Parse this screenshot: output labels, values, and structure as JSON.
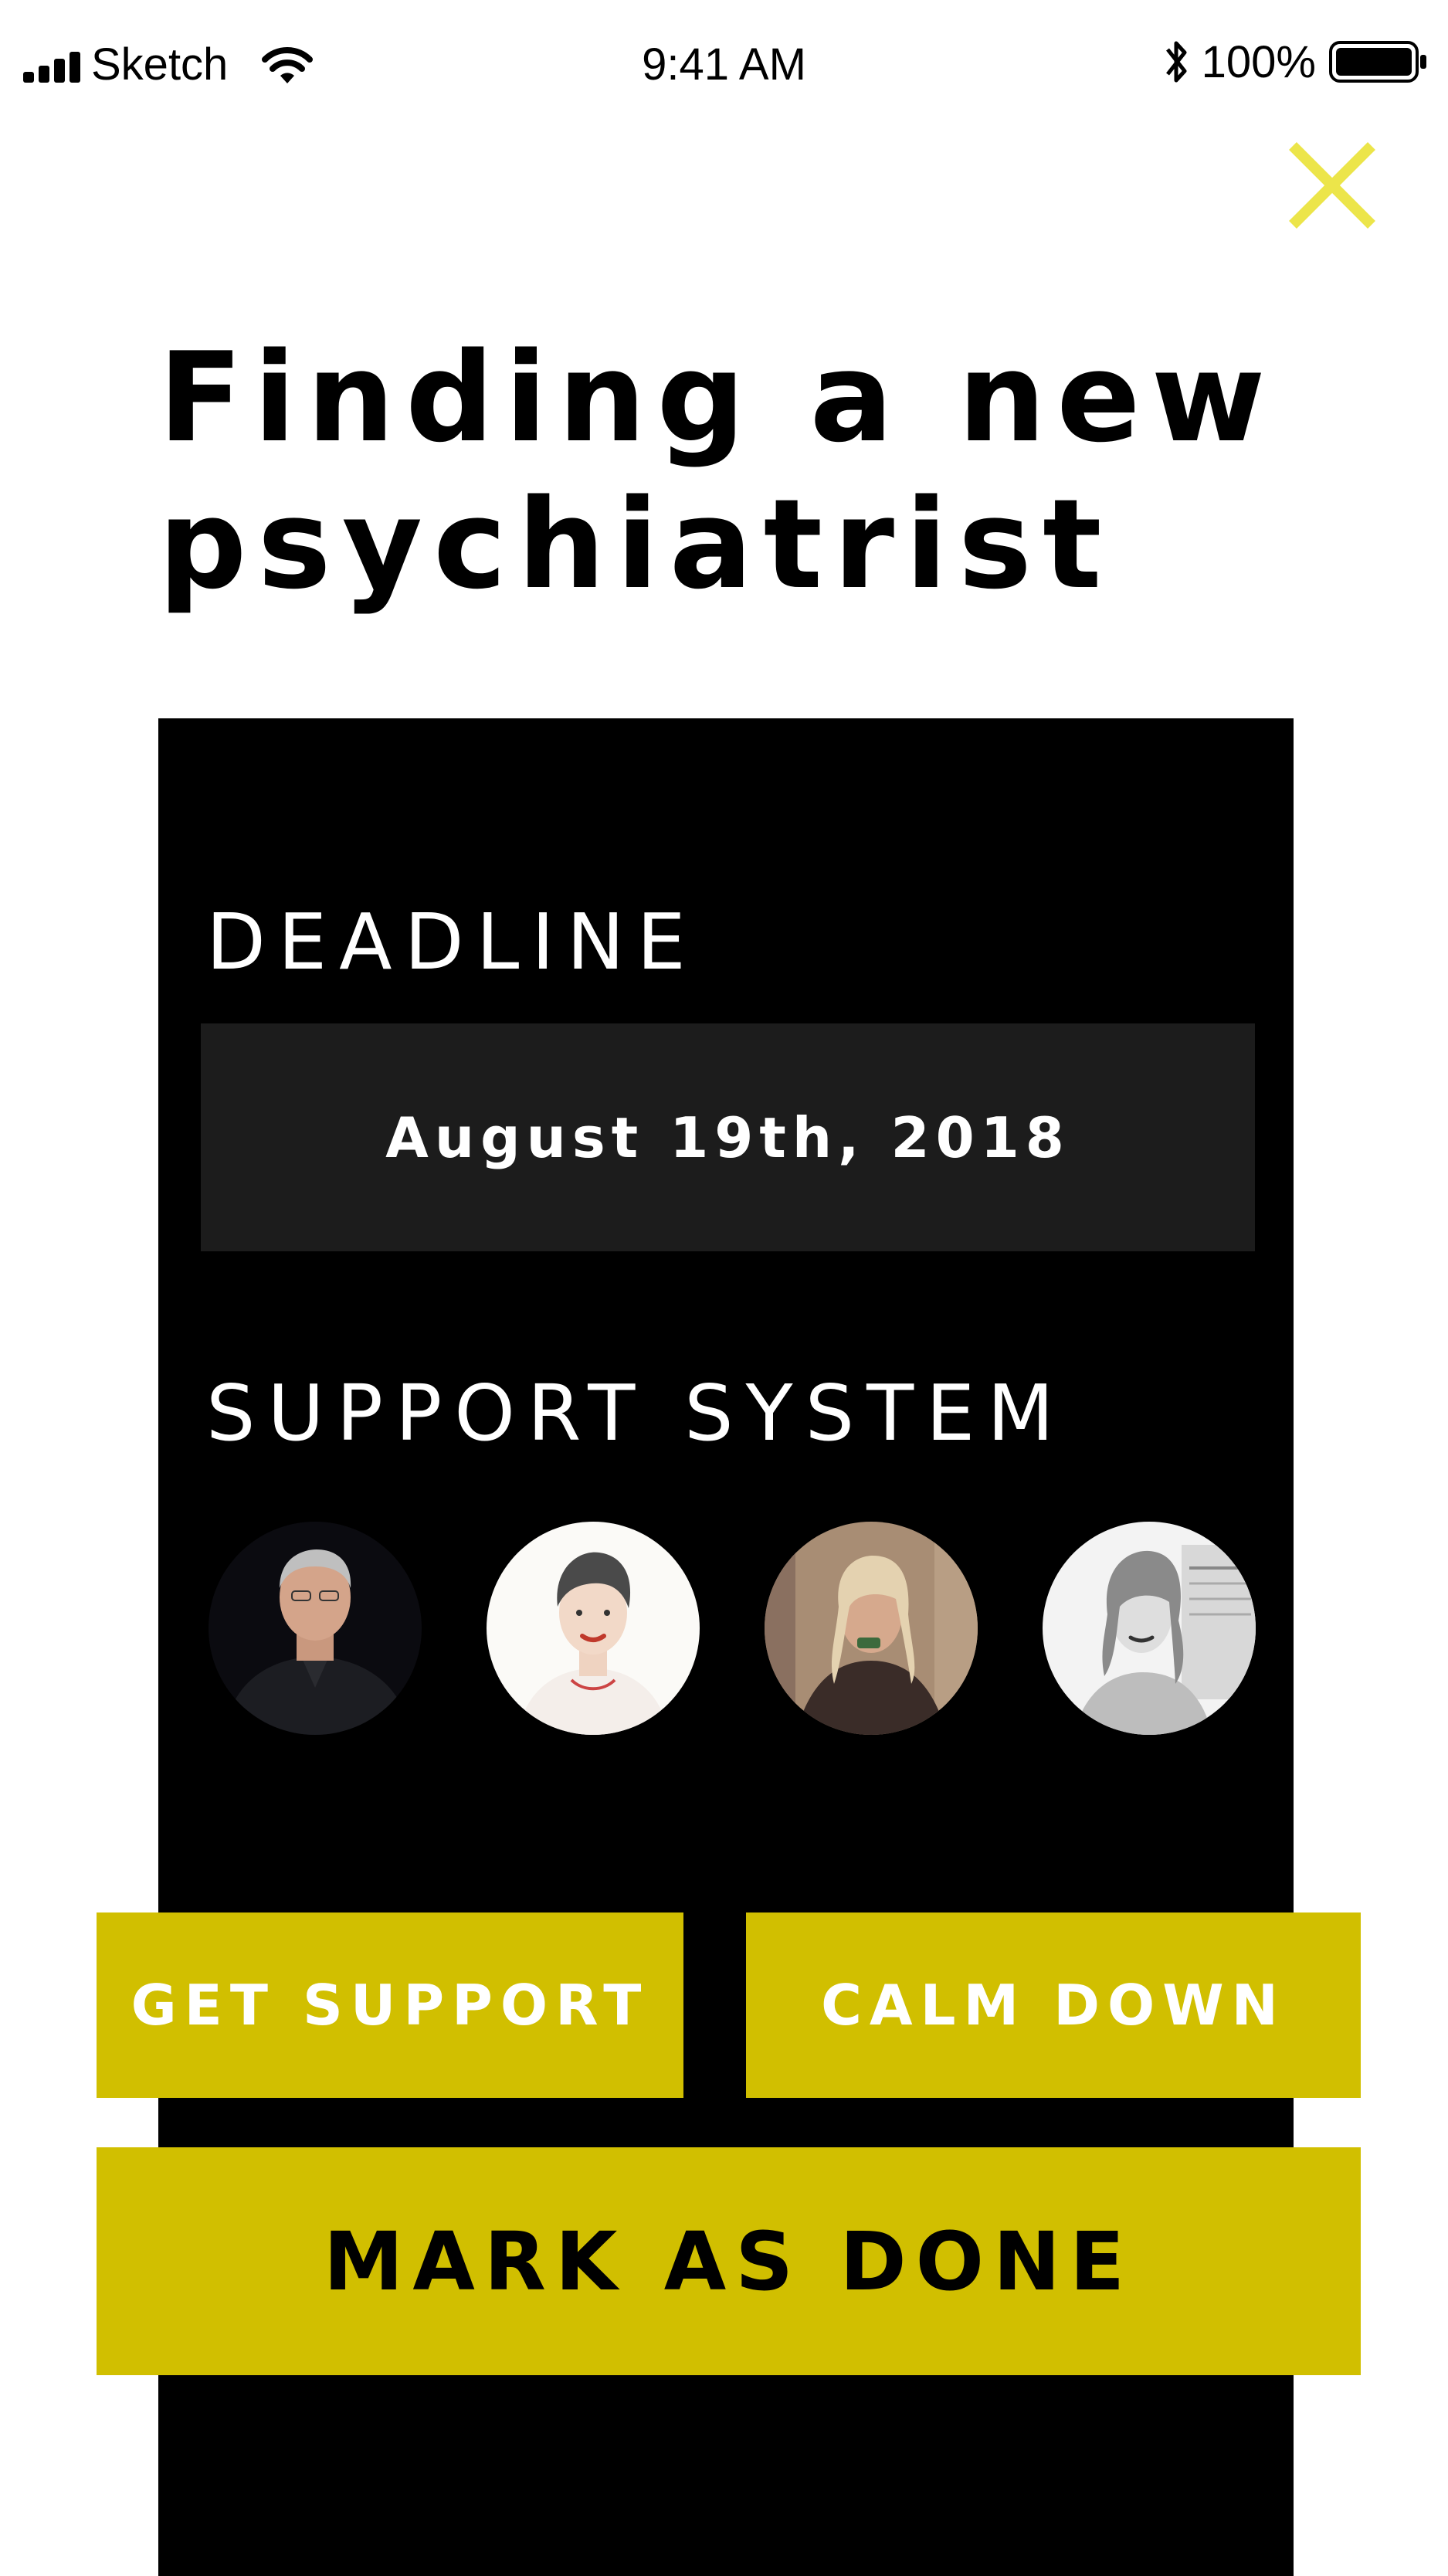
{
  "status_bar": {
    "carrier": "Sketch",
    "time": "9:41 AM",
    "battery_percent": "100%",
    "icons": [
      "signal-icon",
      "wifi-icon",
      "bluetooth-icon",
      "battery-icon"
    ]
  },
  "close": {
    "icon": "close-icon",
    "color": "#ece54a"
  },
  "title": {
    "line1": "Finding a new",
    "line2": "psychiatrist"
  },
  "deadline": {
    "label": "DEADLINE",
    "value": "August 19th, 2018"
  },
  "support_system": {
    "label": "SUPPORT SYSTEM",
    "members": [
      {
        "avatar": "avatar-photo-man-black-shirt"
      },
      {
        "avatar": "avatar-illustrated-portrait"
      },
      {
        "avatar": "avatar-photo-woman-blonde"
      },
      {
        "avatar": "avatar-photo-woman-bw"
      }
    ]
  },
  "actions": {
    "get_support": "GET SUPPORT",
    "calm_down": "CALM DOWN",
    "mark_as_done": "MARK AS DONE"
  },
  "colors": {
    "accent": "#d1bf00",
    "close": "#ece54a",
    "card": "#000000",
    "field": "#1c1c1c"
  }
}
